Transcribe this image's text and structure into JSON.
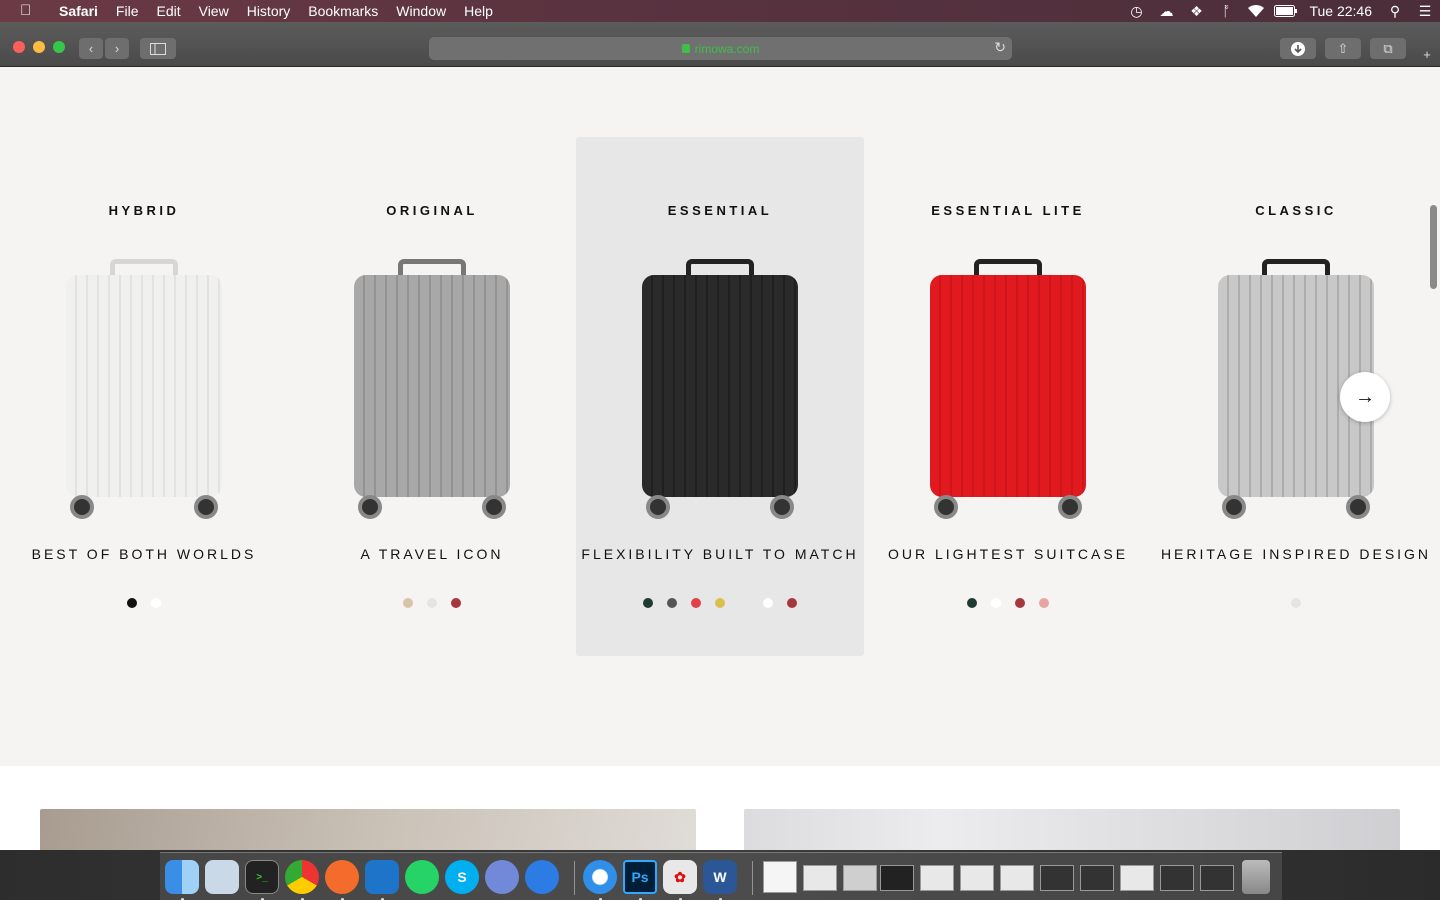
{
  "menubar": {
    "app": "Safari",
    "items": [
      "File",
      "Edit",
      "View",
      "History",
      "Bookmarks",
      "Window"
    ],
    "help": "Help",
    "clock": "Tue 22:46",
    "status_icons": [
      "time-machine-icon",
      "creative-cloud-icon",
      "dropbox-icon",
      "bluetooth-icon",
      "wifi-icon",
      "battery-icon",
      "spotlight-icon",
      "notification-center-icon"
    ]
  },
  "toolbar": {
    "url": "rimowa.com"
  },
  "carousel": {
    "cards": [
      {
        "name": "HYBRID",
        "tagline": "BEST OF BOTH WORLDS",
        "case_color": "#f0f0ef",
        "rib_color": "#dcdcdb",
        "handle_color": "#d6d6d6",
        "swatches": [
          "#111111",
          "#ffffff"
        ]
      },
      {
        "name": "ORIGINAL",
        "tagline": "A TRAVEL ICON",
        "case_color": "#a8a8a8",
        "rib_color": "#8a8a8a",
        "handle_color": "#777777",
        "swatches": [
          "#d8c4a6",
          "#e4e4e4",
          "#a8363f"
        ]
      },
      {
        "name": "ESSENTIAL",
        "tagline": "FLEXIBILITY BUILT TO MATCH",
        "case_color": "#2a2a2a",
        "rib_color": "#1a1a1a",
        "handle_color": "#222222",
        "swatches": [
          "#1f3a32",
          "#555555",
          "#e0404a",
          "#d8c04a",
          "#e8e7e8",
          "#ffffff",
          "#a8363f"
        ]
      },
      {
        "name": "ESSENTIAL LITE",
        "tagline": "OUR LIGHTEST SUITCASE",
        "case_color": "#e01a1f",
        "rib_color": "#c81219",
        "handle_color": "#222222",
        "swatches": [
          "#1f3a32",
          "#ffffff",
          "#a8363f",
          "#e8a4a0"
        ]
      },
      {
        "name": "CLASSIC",
        "tagline": "HERITAGE INSPIRED DESIGN",
        "case_color": "#c8c8c8",
        "rib_color": "#a0a0a0",
        "handle_color": "#222222",
        "swatches": [
          "#e4e4e4"
        ]
      }
    ],
    "next_icon": "arrow-right-icon"
  },
  "dock": {
    "apps": [
      "finder-icon",
      "preview-icon",
      "terminal-icon",
      "chrome-icon",
      "postman-icon",
      "vscode-icon",
      "whatsapp-icon",
      "skype-icon",
      "discord-icon",
      "maps-pin-icon",
      "safari-icon",
      "photoshop-icon",
      "acrobat-icon",
      "word-icon"
    ],
    "labels": {
      "photoshop": "Ps",
      "word": "W",
      "skype": "S"
    }
  }
}
